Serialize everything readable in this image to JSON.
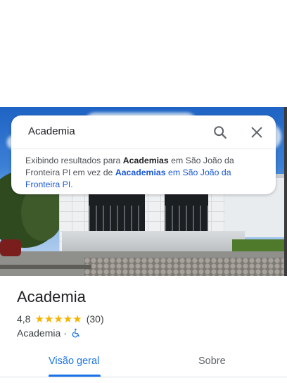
{
  "search": {
    "query": "Academia",
    "notice_prefix": "Exibindo resultados para ",
    "notice_term": "Academias",
    "notice_location": " em São João da Fronteira PI em vez de ",
    "original_term": "Aacademias",
    "original_location": " em São João da Fronteira PI."
  },
  "place": {
    "name": "Academia",
    "rating": "4,8",
    "stars": "★★★★★",
    "review_count": "(30)",
    "category": "Academia",
    "separator": "·",
    "accessibility_icon": "wheelchair-icon"
  },
  "tabs": [
    {
      "label": "Visão geral",
      "active": true
    },
    {
      "label": "Sobre",
      "active": false
    }
  ],
  "colors": {
    "accent": "#1a73e8",
    "star": "#f4b400",
    "link": "#1a58d6"
  }
}
